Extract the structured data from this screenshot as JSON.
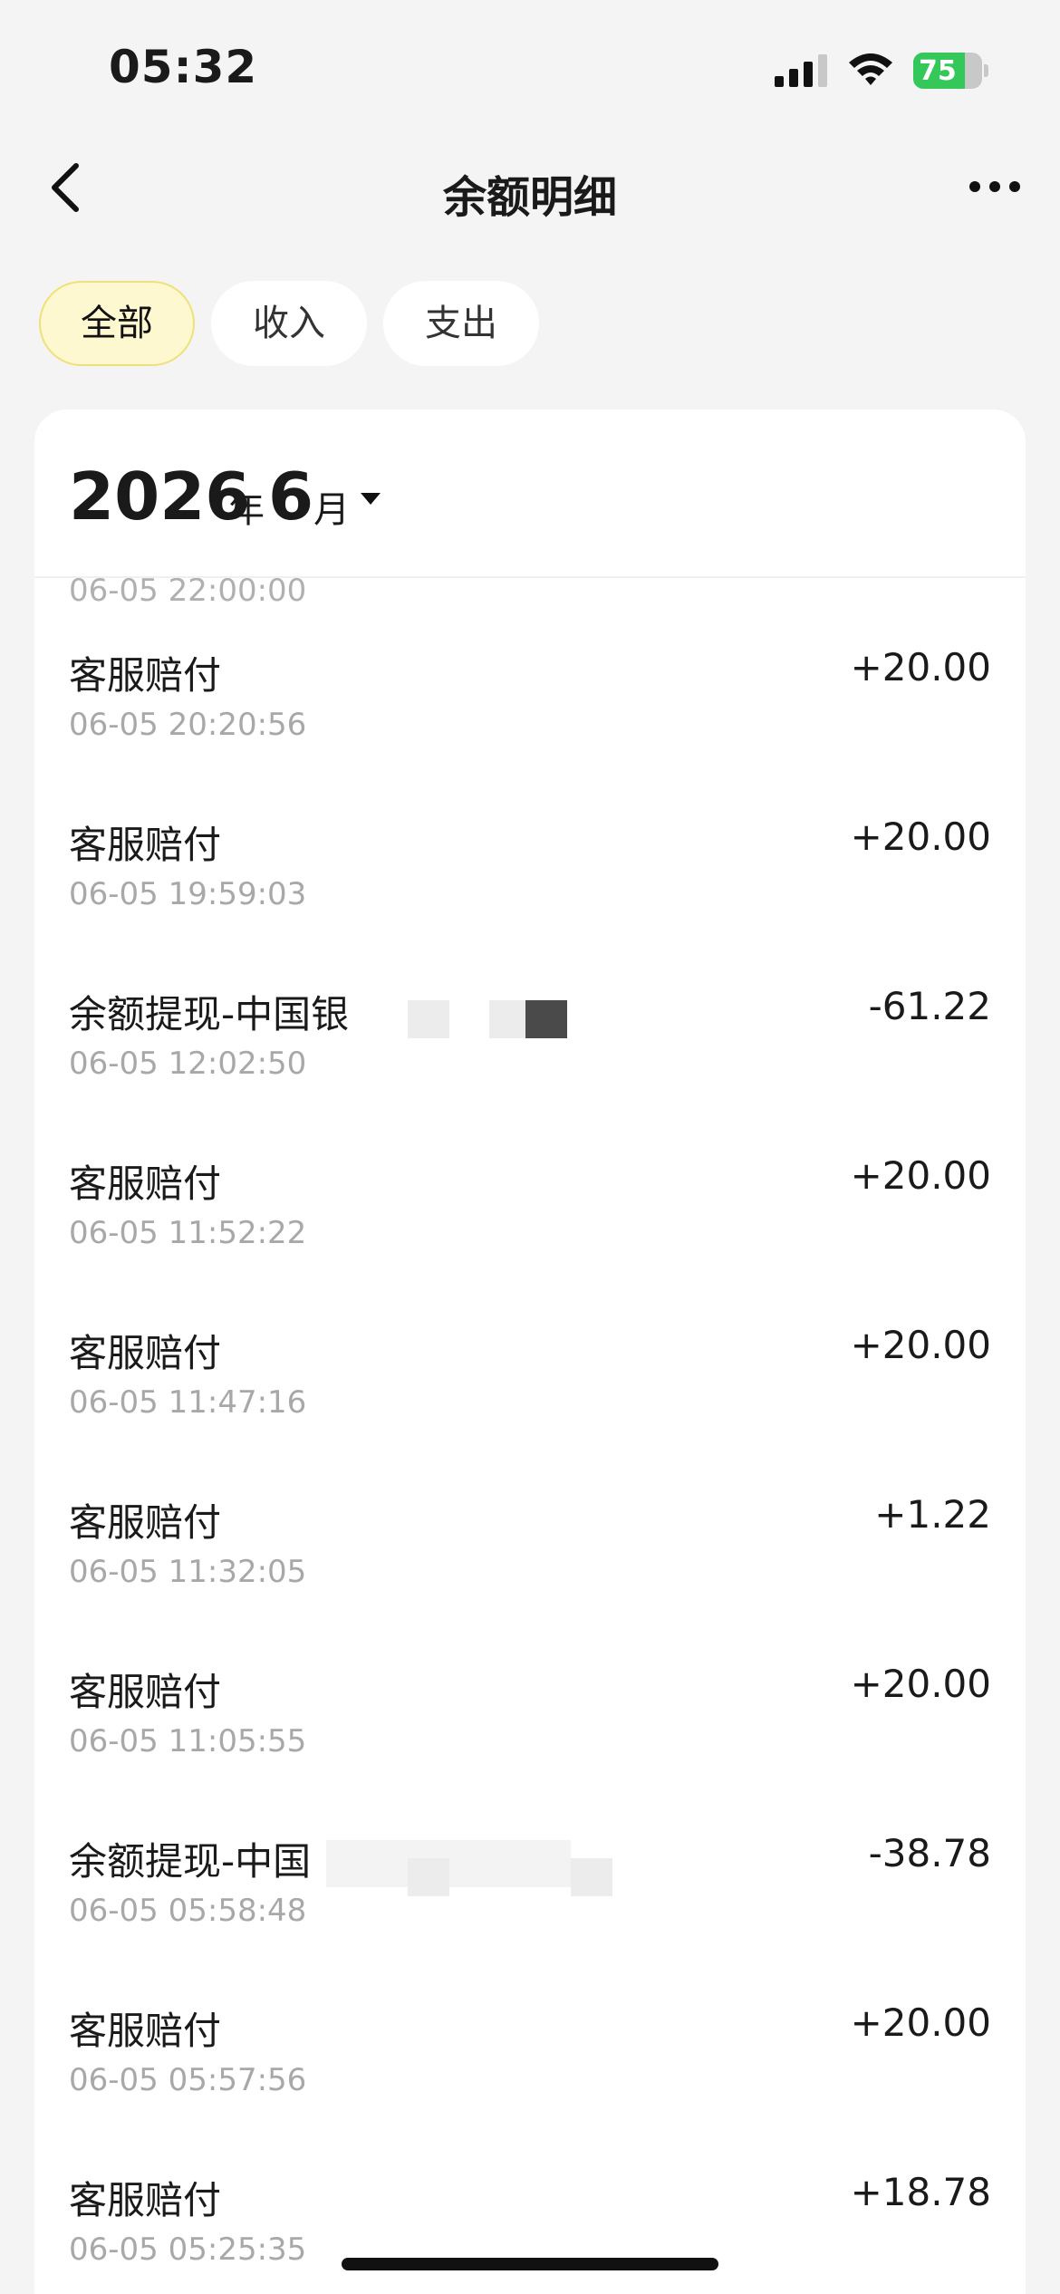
{
  "status_bar": {
    "time": "05:32",
    "battery": "75",
    "battery_level": 0.75,
    "battery_color": "#34c759"
  },
  "nav": {
    "title": "余额明细",
    "back_icon": "chevron-left-icon",
    "more_icon": "ellipsis-icon"
  },
  "tabs": [
    {
      "label": "全部",
      "active": true
    },
    {
      "label": "收入",
      "active": false
    },
    {
      "label": "支出",
      "active": false
    }
  ],
  "accent_color": "#fdf8cf",
  "month_picker": {
    "year": "2026",
    "year_unit": "年",
    "month": "6",
    "month_unit": "月"
  },
  "partial_row_time": "06-05 22:00:00",
  "transactions": [
    {
      "title": "客服赔付",
      "time": "06-05 20:20:56",
      "amount": "+20.00"
    },
    {
      "title": "客服赔付",
      "time": "06-05 19:59:03",
      "amount": "+20.00"
    },
    {
      "title": "余额提现-中国银",
      "time": "06-05 12:02:50",
      "amount": "-61.22"
    },
    {
      "title": "客服赔付",
      "time": "06-05 11:52:22",
      "amount": "+20.00"
    },
    {
      "title": "客服赔付",
      "time": "06-05 11:47:16",
      "amount": "+20.00"
    },
    {
      "title": "客服赔付",
      "time": "06-05 11:32:05",
      "amount": "+1.22"
    },
    {
      "title": "客服赔付",
      "time": "06-05 11:05:55",
      "amount": "+20.00"
    },
    {
      "title": "余额提现-中国",
      "time": "06-05 05:58:48",
      "amount": "-38.78"
    },
    {
      "title": "客服赔付",
      "time": "06-05 05:57:56",
      "amount": "+20.00"
    },
    {
      "title": "客服赔付",
      "time": "06-05 05:25:35",
      "amount": "+18.78"
    }
  ]
}
